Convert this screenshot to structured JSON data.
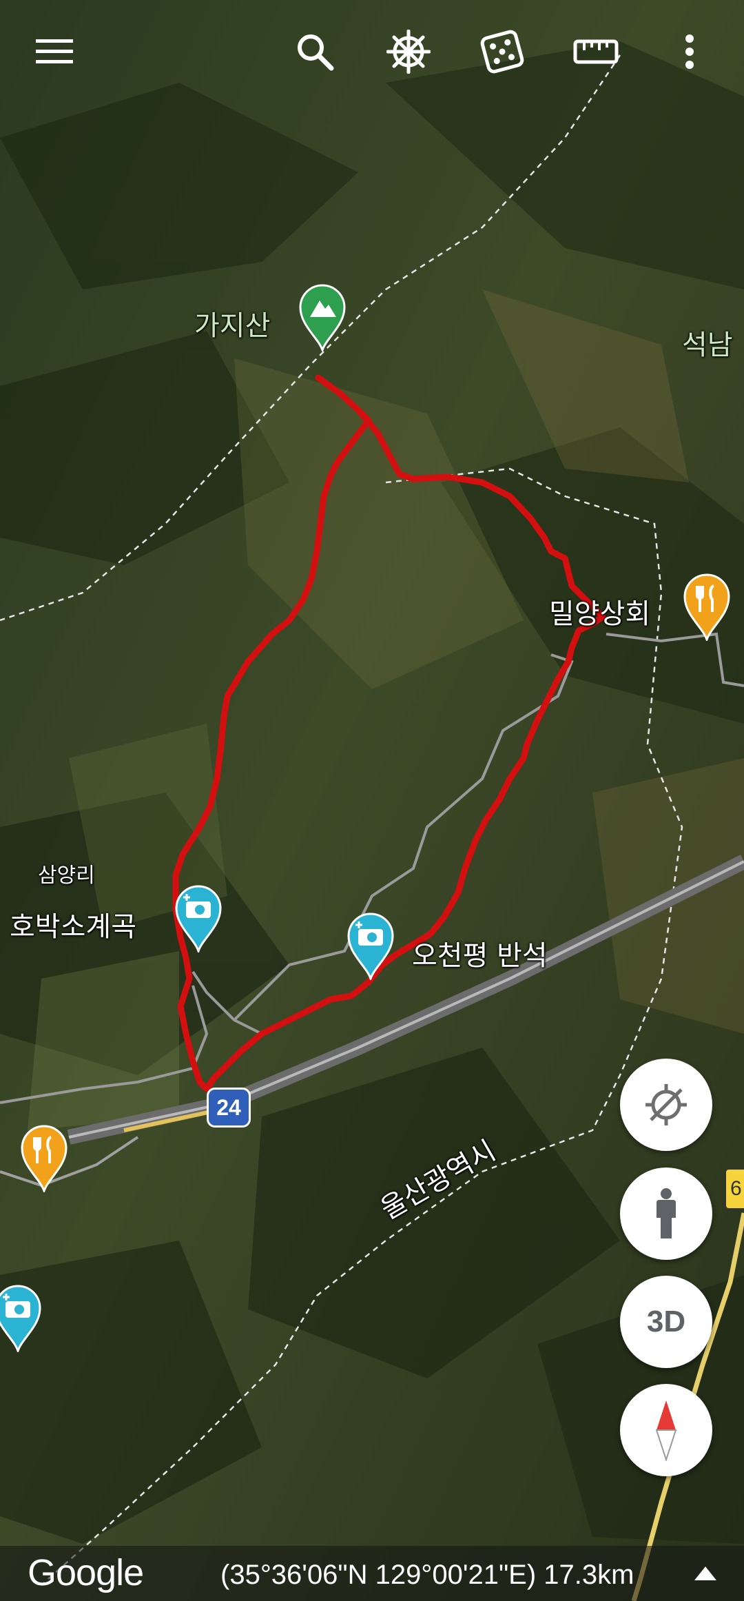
{
  "toolbar": {
    "menu_icon": "menu-icon",
    "search_icon": "search-icon",
    "voyager_icon": "ships-wheel-icon",
    "random_icon": "dice-icon",
    "measure_icon": "ruler-icon",
    "more_icon": "more-vert-icon"
  },
  "places": {
    "mountain": "가지산",
    "top_right": "석남",
    "restaurant": "밀양상회",
    "village": "삼양리",
    "valley": "호박소계곡",
    "viewpoint": "오천평 반석",
    "city_boundary": "울산광역시"
  },
  "road": {
    "route_number": "24",
    "right_sign": "6"
  },
  "fabs": {
    "threed_label": "3D"
  },
  "footer": {
    "brand": "Google",
    "coordinates": "(35°36'06\"N 129°00'21\"E) 17.3km"
  },
  "colors": {
    "route": "#d40f0f",
    "mountain_pin": "#2e9e4f",
    "photo_pin": "#2ab3d2",
    "food_pin": "#f2a21a"
  }
}
